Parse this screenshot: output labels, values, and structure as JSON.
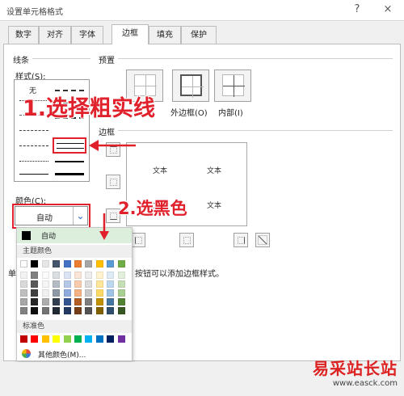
{
  "window": {
    "title": "设置单元格格式",
    "help_icon": "?",
    "close_icon": "×"
  },
  "tabs": [
    {
      "label": "数字",
      "active": false
    },
    {
      "label": "对齐",
      "active": false
    },
    {
      "label": "字体",
      "active": false
    },
    {
      "label": "边框",
      "active": true
    },
    {
      "label": "填充",
      "active": false
    },
    {
      "label": "保护",
      "active": false
    }
  ],
  "line_group": {
    "title": "线条",
    "style_label": "样式(S):",
    "none_label": "无",
    "color_label": "颜色(C):",
    "color_value": "自动"
  },
  "presets": {
    "title": "预置",
    "items": [
      {
        "label": "无(N)"
      },
      {
        "label": "外边框(O)"
      },
      {
        "label": "内部(I)"
      }
    ]
  },
  "border_group": {
    "title": "边框",
    "preview_text": "文本"
  },
  "note": {
    "prefix": "单",
    "text": "按钮可以添加边框样式。"
  },
  "color_dropdown": {
    "auto_label": "自动",
    "theme_header": "主题颜色",
    "standard_header": "标准色",
    "more_colors": "其他颜色(M)...",
    "theme_colors": [
      "#ffffff",
      "#000000",
      "#e7e6e6",
      "#44546a",
      "#4472c4",
      "#ed7d31",
      "#a5a5a5",
      "#ffc000",
      "#5b9bd5",
      "#70ad47"
    ],
    "standard_colors": [
      "#c00000",
      "#ff0000",
      "#ffc000",
      "#ffff00",
      "#92d050",
      "#00b050",
      "#00b0f0",
      "#0070c0",
      "#002060",
      "#7030a0"
    ]
  },
  "annotations": {
    "step1": "1.选择粗实线",
    "step2": "2.选黑色"
  },
  "watermark": {
    "line1": "易采站长站",
    "line2": "www.easck.com"
  },
  "colors": {
    "annotation_red": "#e0202a",
    "active_selection": "#dcefdc"
  }
}
